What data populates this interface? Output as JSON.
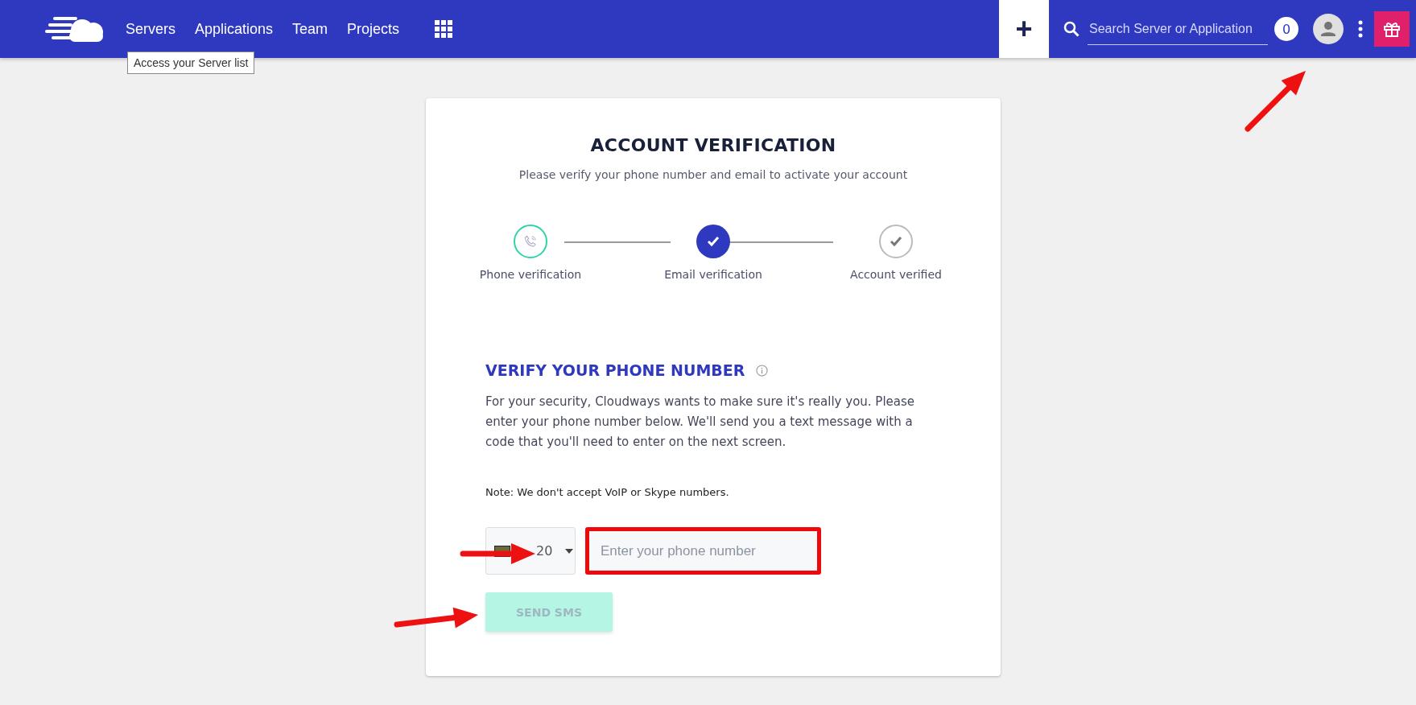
{
  "nav": {
    "items": [
      {
        "label": "Servers"
      },
      {
        "label": "Applications"
      },
      {
        "label": "Team"
      },
      {
        "label": "Projects"
      }
    ],
    "tooltip": "Access your Server list",
    "add_button": "+",
    "search": {
      "placeholder": "Search Server or Application"
    },
    "notification_count": "0"
  },
  "card": {
    "title": "ACCOUNT VERIFICATION",
    "subtitle": "Please verify your phone number and email to activate your account",
    "steps": [
      {
        "label": "Phone verification",
        "kind": "current"
      },
      {
        "label": "Email verification",
        "kind": "done"
      },
      {
        "label": "Account verified",
        "kind": "pending"
      }
    ],
    "section_heading": "VERIFY YOUR PHONE NUMBER",
    "description": "For your security, Cloudways wants to make sure it's really you. Please enter your phone number below. We'll send you a text message with a code that you'll need to enter on the next screen.",
    "note": "Note: We don't accept VoIP or Skype numbers.",
    "dial_code": "20",
    "phone": {
      "placeholder": "Enter your phone number"
    },
    "send_button": {
      "label": "SEND SMS",
      "disabled": true
    }
  }
}
